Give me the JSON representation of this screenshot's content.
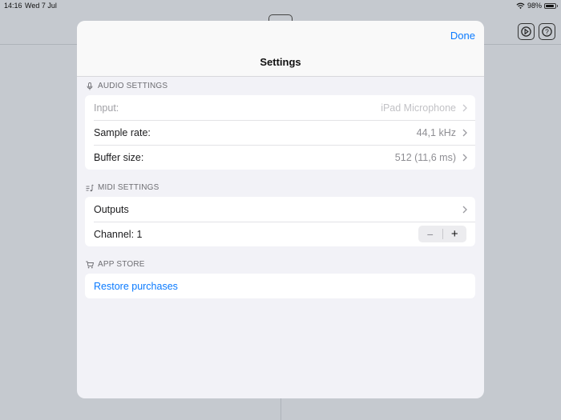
{
  "status_bar": {
    "time": "14:16",
    "date": "Wed 7 Jul",
    "battery": "98%"
  },
  "modal": {
    "title": "Settings",
    "done_label": "Done",
    "sections": {
      "audio": {
        "header": "AUDIO SETTINGS",
        "icon": "microphone-icon",
        "rows": [
          {
            "label": "Input:",
            "value": "iPad Microphone",
            "disabled": true
          },
          {
            "label": "Sample rate:",
            "value": "44,1 kHz"
          },
          {
            "label": "Buffer size:",
            "value": "512 (11,6 ms)"
          }
        ]
      },
      "midi": {
        "header": "MIDI SETTINGS",
        "icon": "music-note-list-icon",
        "rows": [
          {
            "label": "Outputs",
            "value": ""
          },
          {
            "label": "Channel: 1",
            "stepper": {
              "minus": "−",
              "plus": "+"
            }
          }
        ]
      },
      "app_store": {
        "header": "APP STORE",
        "icon": "cart-icon",
        "rows": [
          {
            "label": "Restore purchases"
          }
        ]
      }
    }
  },
  "colors": {
    "accent": "#0a7aff",
    "background": "#c5c9cf",
    "modal_bg": "#f2f2f7"
  }
}
